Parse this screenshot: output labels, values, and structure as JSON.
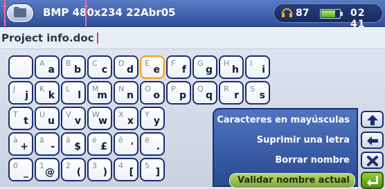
{
  "statusbar": {
    "title": "BMP 480x234 22Abr05",
    "volume": "87",
    "battery_level": 0.85,
    "time": "02 41",
    "icons": {
      "folder": "folder-icon",
      "headphones": "headphones-icon",
      "battery": "battery-icon"
    }
  },
  "editor": {
    "filename": "Project info.doc"
  },
  "keyboard": {
    "rows": [
      [
        {
          "alt": "",
          "main": ""
        },
        {
          "alt": "A",
          "main": "a"
        },
        {
          "alt": "B",
          "main": "b"
        },
        {
          "alt": "C",
          "main": "c"
        },
        {
          "alt": "D",
          "main": "d"
        },
        {
          "alt": "E",
          "main": "e"
        },
        {
          "alt": "F",
          "main": "f"
        },
        {
          "alt": "G",
          "main": "g"
        },
        {
          "alt": "H",
          "main": "h"
        },
        {
          "alt": "I",
          "main": "i"
        }
      ],
      [
        {
          "alt": "J",
          "main": "j"
        },
        {
          "alt": "K",
          "main": "k"
        },
        {
          "alt": "L",
          "main": "l"
        },
        {
          "alt": "M",
          "main": "m"
        },
        {
          "alt": "N",
          "main": "n"
        },
        {
          "alt": "O",
          "main": "o"
        },
        {
          "alt": "P",
          "main": "p"
        },
        {
          "alt": "Q",
          "main": "q"
        },
        {
          "alt": "R",
          "main": "r"
        },
        {
          "alt": "S",
          "main": "s"
        }
      ],
      [
        {
          "alt": "T",
          "main": "t"
        },
        {
          "alt": "U",
          "main": "u"
        },
        {
          "alt": "V",
          "main": "v"
        },
        {
          "alt": "W",
          "main": "w"
        },
        {
          "alt": "X",
          "main": "x"
        },
        {
          "alt": "Y",
          "main": "y"
        }
      ],
      [
        {
          "alt": "à",
          "main": "+"
        },
        {
          "alt": "ä",
          "main": "-"
        },
        {
          "alt": "â",
          "main": "$"
        },
        {
          "alt": "é",
          "main": "£"
        },
        {
          "alt": "ê",
          "main": "'"
        },
        {
          "alt": "ë",
          "main": "."
        }
      ],
      [
        {
          "alt": "0",
          "main": "_"
        },
        {
          "alt": "1",
          "main": "@"
        },
        {
          "alt": "2",
          "main": "("
        },
        {
          "alt": "3",
          "main": ")"
        },
        {
          "alt": "4",
          "main": "["
        },
        {
          "alt": "5",
          "main": "]"
        }
      ]
    ],
    "selected": "e"
  },
  "menu": {
    "items": [
      {
        "label": "Caracteres en mayúsculas",
        "icon": "shift-up-arrow-icon"
      },
      {
        "label": "Suprimir una letra",
        "icon": "backspace-left-arrow-icon"
      },
      {
        "label": "Borrar nombre",
        "icon": "clear-x-icon"
      },
      {
        "label": "Validar nombre actual",
        "icon": "enter-return-icon",
        "active": true
      }
    ]
  },
  "colors": {
    "statusbar": "#2f4f96",
    "key_border": "#1c2d6e",
    "selected_key_border": "#f3a22a",
    "menu_bg": "#3b60ad",
    "active_item": "#9cc44f",
    "cursor": "#e83b58"
  }
}
